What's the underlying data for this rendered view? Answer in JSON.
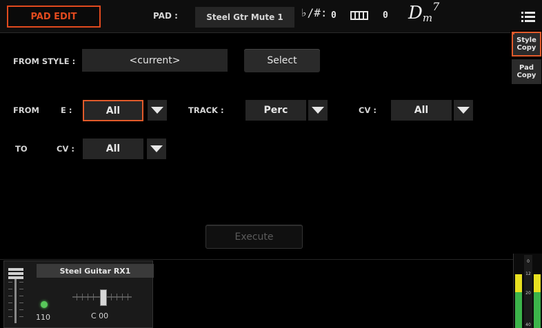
{
  "topbar": {
    "mode": "PAD EDIT",
    "pad_label": "PAD :",
    "pad_name": "Steel Gtr Mute 1",
    "transpose_symbol": "♭/#:",
    "transpose_value": "0",
    "octave_value": "0",
    "chord_root": "D",
    "chord_quality": "m",
    "chord_ext": "7"
  },
  "form": {
    "from_style_label": "FROM STYLE :",
    "from_style_value": "<current>",
    "select_label": "Select",
    "from_label": "FROM",
    "e_label": "E :",
    "e_value": "All",
    "track_label": "TRACK :",
    "track_value": "Perc",
    "cv_from_label": "CV :",
    "cv_from_value": "All",
    "to_label": "TO",
    "cv_to_label": "CV :",
    "cv_to_value": "All",
    "execute_label": "Execute"
  },
  "side_tabs": [
    {
      "line1": "Style",
      "line2": "Copy"
    },
    {
      "line1": "Pad",
      "line2": "Copy"
    }
  ],
  "track": {
    "name": "Steel Guitar RX1",
    "volume": "110",
    "pan": "C 00"
  },
  "meter": {
    "scale": [
      "0",
      "12",
      "20",
      "40"
    ],
    "left_level": 0.72,
    "right_level": 0.72
  },
  "colors": {
    "accent": "#e25a2a",
    "led": "#58c85a",
    "meter_yellow": "#e8e020",
    "meter_green": "#3cb44a"
  }
}
